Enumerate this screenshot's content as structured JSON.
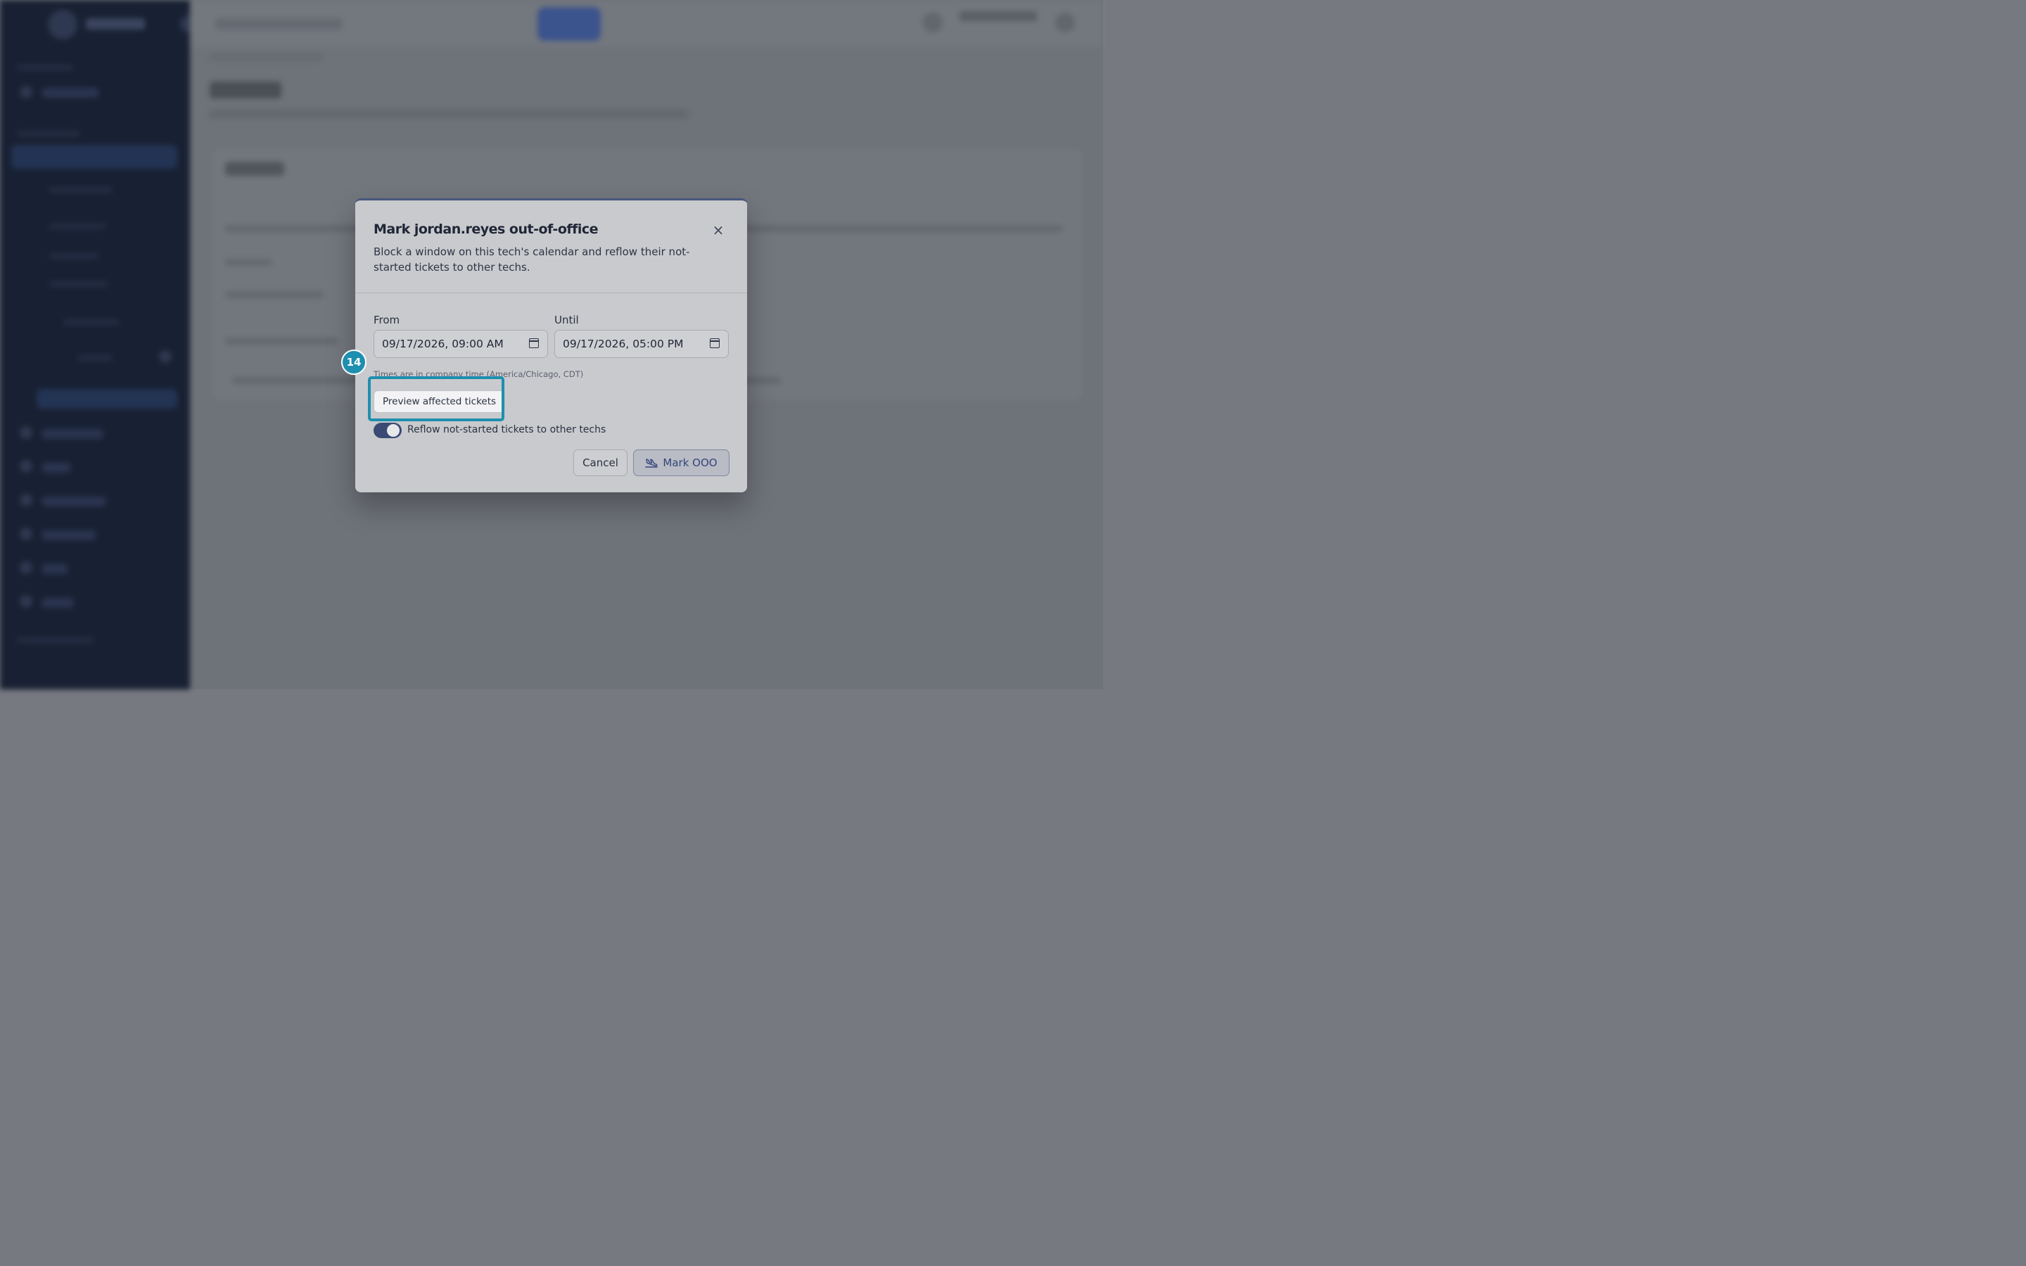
{
  "modal": {
    "title": "Mark jordan.reyes out-of-office",
    "description": "Block a window on this tech's calendar and reflow their not-started tickets to other techs.",
    "from_label": "From",
    "from_value": "09/17/2026, 09:00 AM",
    "until_label": "Until",
    "until_value": "09/17/2026, 05:00 PM",
    "timezone_note": "Times are in company time (America/Chicago, CDT)",
    "preview_button": "Preview affected tickets",
    "reflow_toggle_label": "Reflow not-started tickets to other techs",
    "reflow_enabled": true,
    "cancel_button": "Cancel",
    "confirm_button": "Mark OOO",
    "close_glyph": "×"
  },
  "annotation": {
    "step_number": "14",
    "highlight_color": "#1e8fae"
  },
  "colors": {
    "sidebar_bg": "#111a2e",
    "accent": "#3a4a74"
  },
  "icons": {
    "close": "close-icon",
    "calendar": "calendar-icon",
    "confirm": "airplane-landing-icon"
  }
}
